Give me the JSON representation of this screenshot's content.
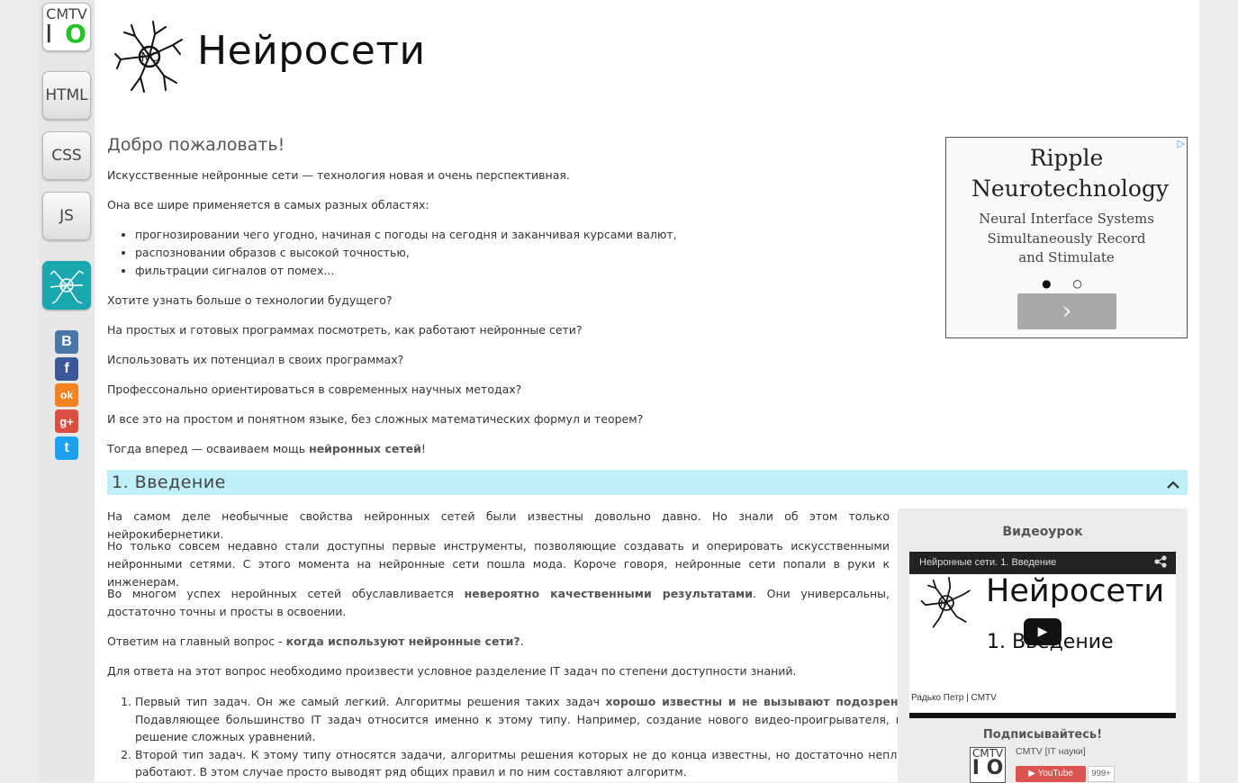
{
  "sidebar": {
    "logo": {
      "top": "CMTV",
      "i": "I",
      "o": "O"
    },
    "buttons": [
      {
        "label": "HTML"
      },
      {
        "label": "CSS"
      },
      {
        "label": "JS"
      }
    ],
    "nc_label": "NC",
    "social": [
      {
        "name": "vkontakte",
        "glyph": "B",
        "color": "#4a76a8"
      },
      {
        "name": "facebook",
        "glyph": "f",
        "color": "#3b5998"
      },
      {
        "name": "odnoklassniki",
        "glyph": "ok",
        "color": "#f58220"
      },
      {
        "name": "google-plus",
        "glyph": "g+",
        "color": "#dc4e41"
      },
      {
        "name": "twitter",
        "glyph": "t",
        "color": "#1da1f2"
      }
    ]
  },
  "header": {
    "logo_label": "NC",
    "title": "Нейросети"
  },
  "welcome": {
    "heading": "Добро пожаловать!",
    "p1": "Искусственные нейронные сети — технология новая и очень перспективная.",
    "p2": "Она все шире применяется в самых разных областях:",
    "bullets": [
      "прогнозировании чего угодно, начиная с погоды на сегодня и заканчивая курсами валют,",
      "распозновании образов с высокой точностью,",
      "фильтрации сигналов от помех..."
    ],
    "q1": "Хотите узнать больше о технологии будущего?",
    "q2": "На простых и готовых программах посмотреть, как работают нейронные сети?",
    "q3": "Использовать их потенциал в своих программах?",
    "q4": "Профессонально ориентироваться в современных научных методах?",
    "q5": "И все это на простом и понятном языке, без сложных математических формул и теорем?",
    "final_pre": "Тогда вперед — осваиваем мощь ",
    "final_bold": "нейронных сетей",
    "final_post": "!"
  },
  "section": {
    "title": "1. Введение",
    "p1": "На самом деле необычные свойства нейронных сетей были известны довольно давно. Но знали об этом только нейрокибернетики.",
    "p2": "Но только совсем недавно стали доступны первые инструменты, позволяющие создавать и оперировать искусственными нейронными сетями. С этого момента на нейронные сети пошла мода. Короче говоря, нейронные сети попали в руки к инженерам.",
    "p3_pre": "Во многом успех неройнных сетей обуславливается ",
    "p3_bold": "невероятно качественными результатами",
    "p3_post": ". Они универсальны, достаточно точны и просты в освоении.",
    "p4_pre": "Ответим на главный вопрос - ",
    "p4_bold": "когда используют нейронные сети?",
    "p4_post": ".",
    "p5": "Для ответа на этот вопрос необходимо произвести условное разделение IT задач по степени доступности знаний.",
    "item1_pre": "Первый тип задач. Он же самый легкий. Алгоритмы решения таких задач ",
    "item1_bold": "хорошо известны и не вызывают подозрений",
    "item1_post": ". Подавляющее большинство IT задач относится именно к этому типу. Например, создание нового видео-проигрывателя, или решение сложных уравнений.",
    "item2": "Второй тип задач. К этому типу относятся задачи, алгоритмы решения которых не до конца известны, но достаточно неплохо работают. В этом случае просто выводят ряд общих правил и по ним составляют алгоритм."
  },
  "ad": {
    "headline": "Ripple Neurotechnology",
    "text": "Neural Interface Systems Simultaneously Record and Stimulate",
    "dots": "● ○",
    "next": "›"
  },
  "video": {
    "heading": "Видеоурок",
    "bar_title": "Нейронные сети. 1. Введение",
    "player_logo": "NC",
    "player_title": "Нейросети",
    "episode": "1. Введение",
    "author": "Радько Петр | CMTV",
    "subscribe": "Подписывайтесь!",
    "channel_logo_top": "CMTV",
    "channel_logo_io": "I O",
    "channel": "CMTV [IT науки]",
    "youtube": "▶ YouTube",
    "count": "999+"
  }
}
